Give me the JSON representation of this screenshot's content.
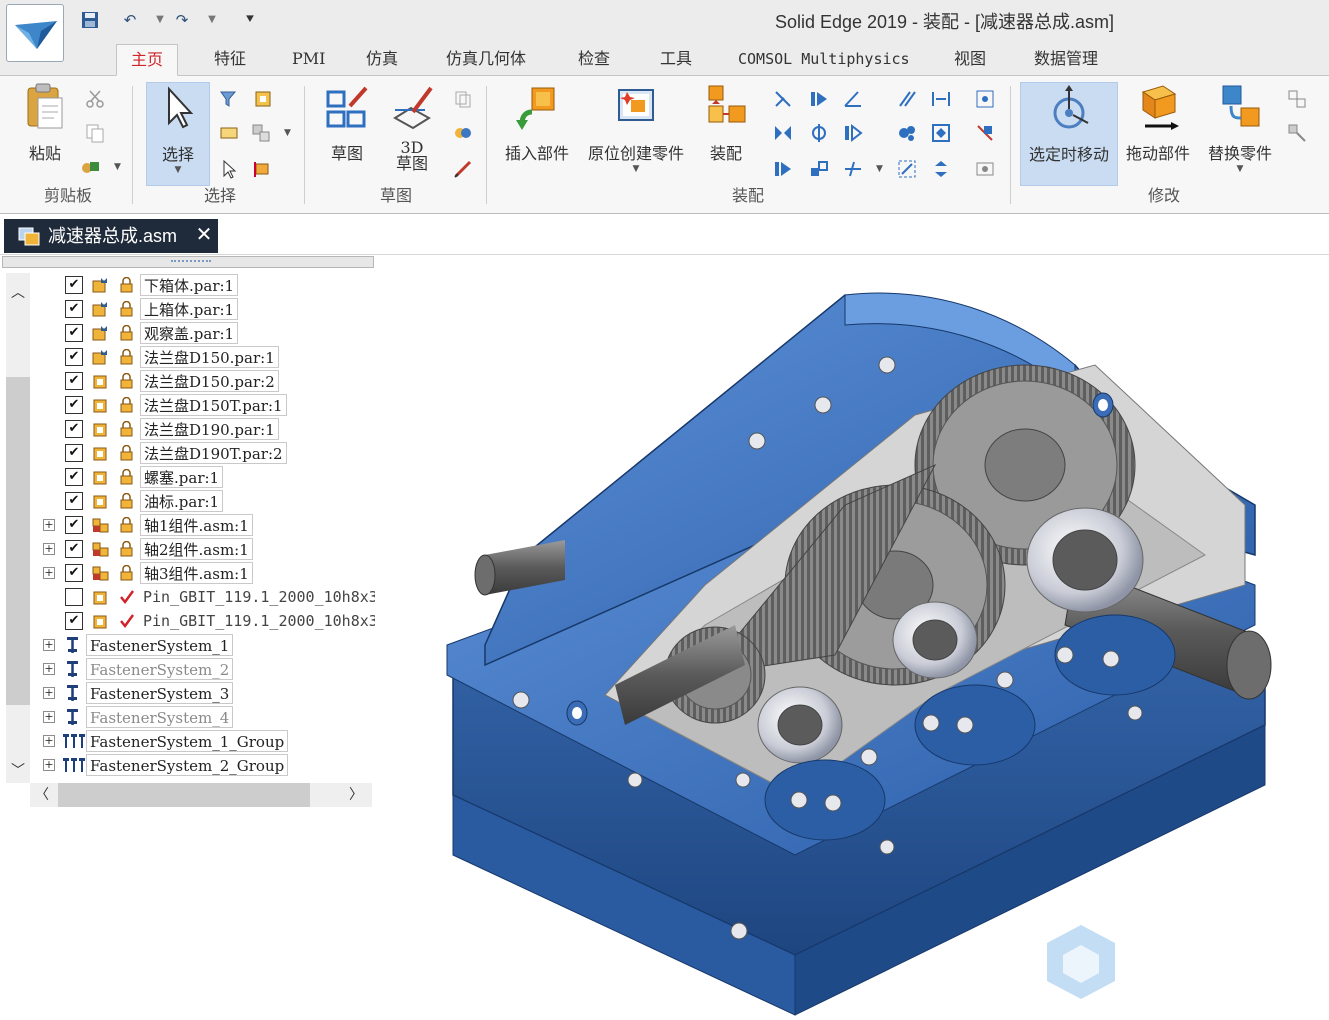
{
  "window": {
    "title": "Solid Edge 2019 - 装配 - [减速器总成.asm]"
  },
  "ribbon_tabs": [
    {
      "label": "主页",
      "active": true
    },
    {
      "label": "特征"
    },
    {
      "label": "PMI"
    },
    {
      "label": "仿真"
    },
    {
      "label": "仿真几何体"
    },
    {
      "label": "检查"
    },
    {
      "label": "工具"
    },
    {
      "label": "COMSOL Multiphysics"
    },
    {
      "label": "视图"
    },
    {
      "label": "数据管理"
    }
  ],
  "ribbon": {
    "paste_label": "粘贴",
    "select_label": "选择",
    "sketch_label": "草图",
    "sketch3d_label": "3D\n草图",
    "insert_part_label": "插入部件",
    "create_inplace_label": "原位创建零件",
    "assemble_label": "装配",
    "move_on_select_label": "选定时移动",
    "drag_component_label": "拖动部件",
    "replace_part_label": "替换零件",
    "groups": {
      "clipboard": "剪贴板",
      "select": "选择",
      "sketch": "草图",
      "assemble": "装配",
      "modify": "修改"
    }
  },
  "document_tab": {
    "label": "减速器总成.asm",
    "close_glyph": "✕"
  },
  "tree": {
    "items": [
      {
        "label": "下箱体.par:1",
        "checked": true,
        "icon": "part-active-icon"
      },
      {
        "label": "上箱体.par:1",
        "checked": true,
        "icon": "part-active-icon"
      },
      {
        "label": "观察盖.par:1",
        "checked": true,
        "icon": "part-active-icon"
      },
      {
        "label": "法兰盘D150.par:1",
        "checked": true,
        "icon": "part-active-icon"
      },
      {
        "label": "法兰盘D150.par:2",
        "checked": true,
        "icon": "part-icon"
      },
      {
        "label": "法兰盘D150T.par:1",
        "checked": true,
        "icon": "part-icon"
      },
      {
        "label": "法兰盘D190.par:1",
        "checked": true,
        "icon": "part-icon"
      },
      {
        "label": "法兰盘D190T.par:2",
        "checked": true,
        "icon": "part-icon"
      },
      {
        "label": "螺塞.par:1",
        "checked": true,
        "icon": "part-icon"
      },
      {
        "label": "油标.par:1",
        "checked": true,
        "icon": "part-icon"
      },
      {
        "label": "轴1组件.asm:1",
        "checked": true,
        "icon": "subassembly-icon",
        "expandable": true
      },
      {
        "label": "轴2组件.asm:1",
        "checked": true,
        "icon": "subassembly-icon",
        "expandable": true
      },
      {
        "label": "轴3组件.asm:1",
        "checked": true,
        "icon": "subassembly-icon",
        "expandable": true
      },
      {
        "label": "Pin_GBIT_119.1_2000_10h8x3",
        "checked": false,
        "icon": "pin-icon"
      },
      {
        "label": "Pin_GBIT_119.1_2000_10h8x3",
        "checked": true,
        "icon": "pin-icon"
      }
    ],
    "fasteners": [
      {
        "label": "FastenerSystem_1",
        "dim": false
      },
      {
        "label": "FastenerSystem_2",
        "dim": true
      },
      {
        "label": "FastenerSystem_3",
        "dim": false
      },
      {
        "label": "FastenerSystem_4",
        "dim": true
      },
      {
        "label": "FastenerSystem_1_Group",
        "dim": false,
        "group": true
      },
      {
        "label": "FastenerSystem_2_Group",
        "dim": false,
        "group": true
      }
    ],
    "check_glyph": "✔",
    "expand_glyph": "+"
  },
  "scroll": {
    "up": "︿",
    "down": "﹀",
    "left": "〈",
    "right": "〉"
  },
  "colors": {
    "accent": "#d1232a",
    "housing_blue": "#3a6db5",
    "housing_dark": "#234b86",
    "selected_button": "#c9dcf2"
  }
}
